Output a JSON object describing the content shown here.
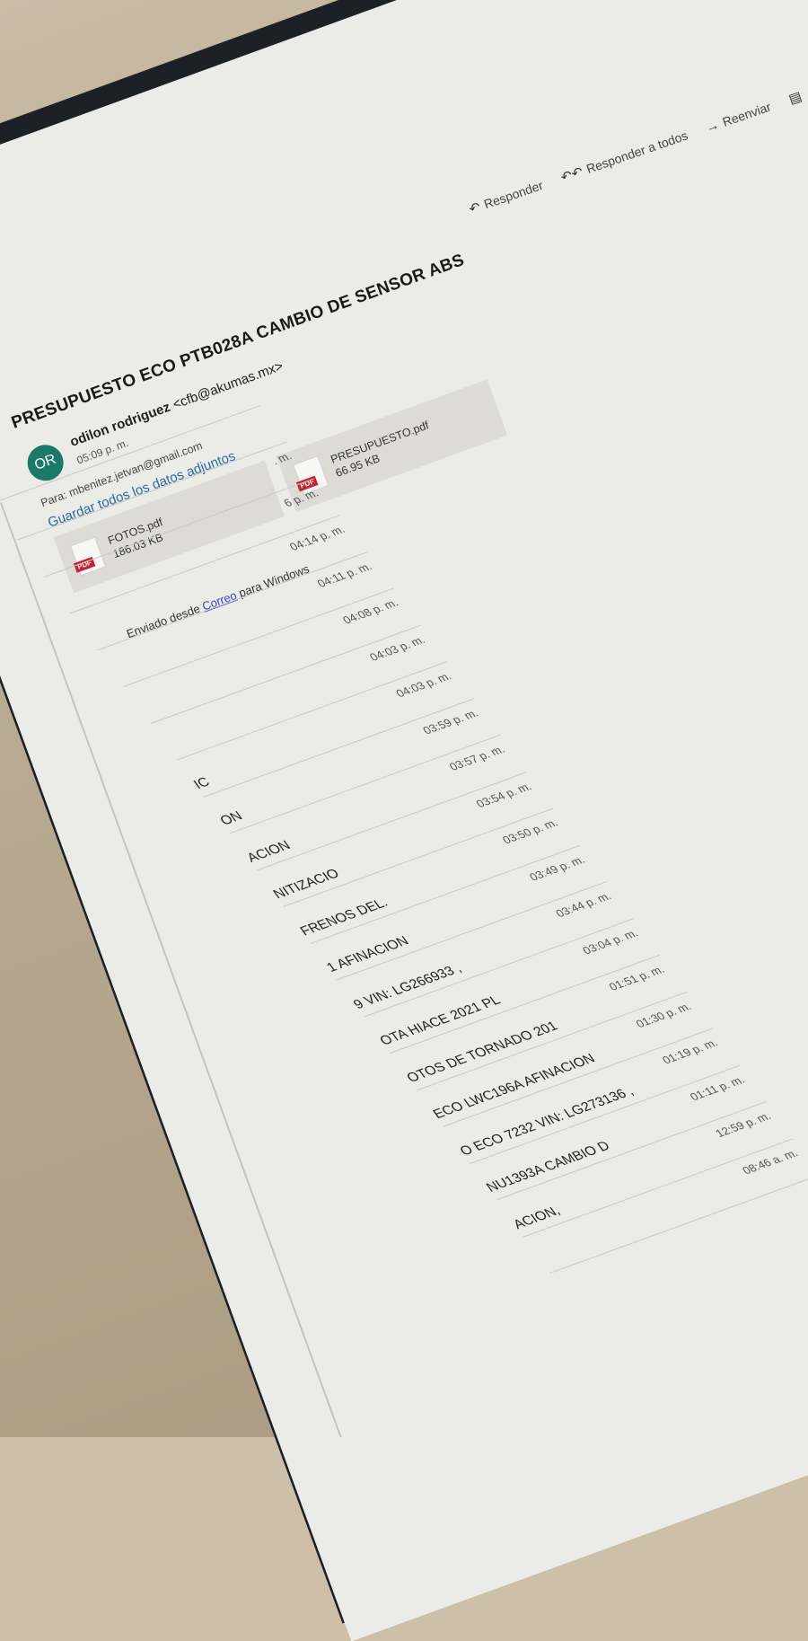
{
  "toolbar": {
    "reply_label": "Responder",
    "reply_all_label": "Responder a todos",
    "forward_label": "Reenviar"
  },
  "message": {
    "subject": "PRESUPUESTO ECO PTB028A CAMBIO DE SENSOR ABS",
    "sender_name": "odilon rodriguez",
    "sender_email": "<cfb@akumas.mx>",
    "avatar_initials": "OR",
    "time": "05:09 p. m.",
    "to_line": "Para: mbenitez.jetvan@gmail.com",
    "save_all_label": "Guardar todos los datos adjuntos",
    "attachments": [
      {
        "name": "FOTOS.pdf",
        "size": "186.03 KB",
        "icon_label": "PDF"
      },
      {
        "name": "PRESUPUESTO.pdf",
        "size": "66.95 KB",
        "icon_label": "PDF"
      }
    ],
    "body_prefix": "Enviado desde",
    "body_link": "Correo",
    "body_suffix": "para Windows"
  },
  "message_list": [
    {
      "subject": "",
      "time": ""
    },
    {
      "subject": "",
      "time": ""
    },
    {
      "subject": "",
      "time": ". m."
    },
    {
      "subject": "",
      "time": "6 p. m."
    },
    {
      "subject": "",
      "time": "04:14 p. m."
    },
    {
      "subject": "",
      "time": "04:11 p. m."
    },
    {
      "subject": "",
      "time": "04:08 p. m."
    },
    {
      "subject": "",
      "time": "04:03 p. m."
    },
    {
      "subject": "IC",
      "time": "04:03 p. m."
    },
    {
      "subject": "ON",
      "time": "03:59 p. m."
    },
    {
      "subject": "ACION",
      "time": "03:57 p. m."
    },
    {
      "subject": "NITIZACIO",
      "time": "03:54 p. m."
    },
    {
      "subject": "FRENOS DEL.",
      "time": "03:50 p. m."
    },
    {
      "subject": "1 AFINACION",
      "time": "03:49 p. m."
    },
    {
      "subject": "9 VIN: LG266933 ,",
      "time": "03:44 p. m."
    },
    {
      "subject": "OTA HIACE  2021 PL",
      "time": "03:04 p. m."
    },
    {
      "subject": "OTOS DE TORNADO 201",
      "time": "01:51 p. m."
    },
    {
      "subject": "ECO LWC196A AFINACION",
      "time": "01:30 p. m."
    },
    {
      "subject": "O ECO 7232 VIN: LG273136 ,",
      "time": "01:19 p. m."
    },
    {
      "subject": "NU1393A CAMBIO D",
      "time": "01:11 p. m."
    },
    {
      "subject": "ACION,",
      "time": "12:59 p. m."
    },
    {
      "subject": "",
      "time": "08:46 a. m."
    }
  ]
}
